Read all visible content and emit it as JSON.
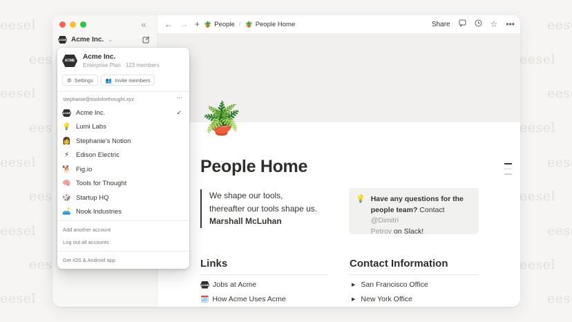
{
  "watermark": "eesel",
  "sidebar": {
    "workspace_name": "Acme Inc.",
    "logo_text": "ACME"
  },
  "topbar": {
    "breadcrumb_parent": "People",
    "breadcrumb_sep": "/",
    "breadcrumb_current": "People Home",
    "share_label": "Share"
  },
  "page": {
    "title": "People Home",
    "icon": "🪴",
    "quote_line1": "We shape our tools,",
    "quote_line2": "thereafter our tools shape us.",
    "quote_author": "Marshall McLuhan",
    "callout_bold1": "Have any questions for the",
    "callout_bold2": "people team?",
    "callout_text1": " Contact ",
    "callout_mention1": "@Dimitri",
    "callout_mention2": "Petrov",
    "callout_text2": " on Slack!"
  },
  "links": {
    "heading": "Links",
    "items": [
      {
        "icon": "acme-logo",
        "label": "Jobs at Acme"
      },
      {
        "icon": "🗓️",
        "label": "How Acme Uses Acme"
      }
    ]
  },
  "contact": {
    "heading": "Contact Information",
    "items": [
      "San Francisco Office",
      "New York Office"
    ]
  },
  "dropdown": {
    "name": "Acme Inc.",
    "plan": "Enterprise Plan · 123 members",
    "settings_label": "Settings",
    "invite_label": "Invite members",
    "email": "stephanie@toolsforthought.xyz",
    "more_label": "···",
    "workspaces": [
      {
        "icon": "acme-logo",
        "label": "Acme Inc.",
        "selected": true
      },
      {
        "icon": "💡",
        "label": "Lumi Labs"
      },
      {
        "icon": "👩",
        "label": "Stephanie's Notion"
      },
      {
        "icon": "⚡",
        "label": "Edison Electric"
      },
      {
        "icon": "🐕",
        "label": "Fig.io"
      },
      {
        "icon": "🧠",
        "label": "Tools for Thought"
      },
      {
        "icon": "🎲",
        "label": "Startup HQ"
      },
      {
        "icon": "🛋️",
        "label": "Nook Industries"
      }
    ],
    "add_account": "Add another account",
    "logout_all": "Log out all accounts",
    "get_app": "Get iOS & Android app",
    "check": "✓"
  },
  "colors": {
    "traffic_red": "#ff5f57",
    "traffic_yellow": "#febc2e",
    "traffic_green": "#28c840",
    "cover": "#f1f0ee",
    "callout_bg": "#f1f1ef"
  }
}
